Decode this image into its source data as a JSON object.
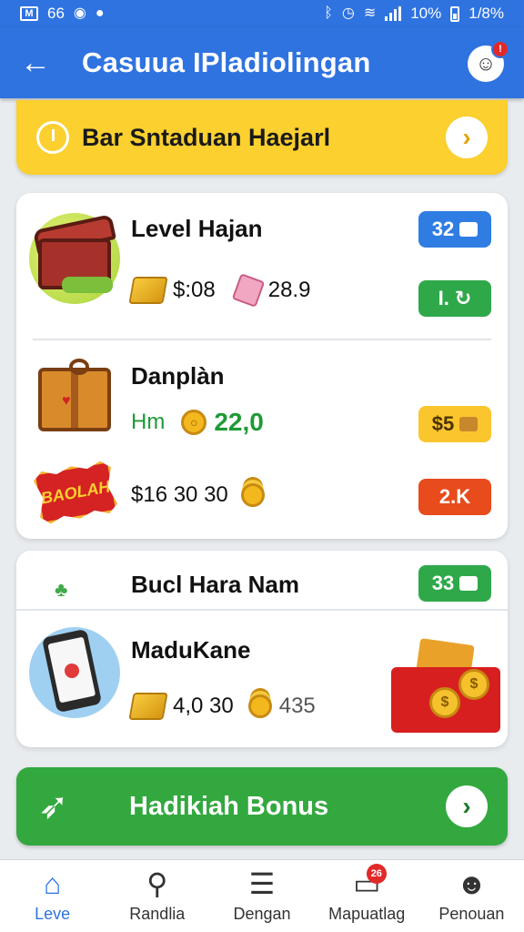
{
  "status_bar": {
    "left_text": "66",
    "right_text": "1/8%",
    "pct_text": "10%",
    "icons": [
      "mail-icon",
      "circle-icon",
      "chat-bubble-icon",
      "bluetooth-icon",
      "alarm-icon",
      "wifi-icon",
      "signal-icon",
      "battery-icon"
    ]
  },
  "app_bar": {
    "title": "Casuua IPladiolingan",
    "back_icon": "arrow-left-icon",
    "action_icon": "user-alert-icon"
  },
  "banner": {
    "text": "Bar Sntaduan Haejarl",
    "icon": "clock-icon"
  },
  "card1": {
    "rows": [
      {
        "title": "Level Hajan",
        "left_value": "$:08",
        "right_value": "28.9",
        "pill_top": "32",
        "pill_bottom": "I."
      },
      {
        "title": "Danplàn",
        "prefix": "Hm",
        "amount": "22,0",
        "pill": "$5"
      },
      {
        "badge_text": "BAOLAH",
        "value": "$16 30 30",
        "pill": "2.K"
      }
    ]
  },
  "card2": {
    "title": "Bucl Hara Nam",
    "pill": "33",
    "sub_title": "MaduKane",
    "left_value": "4,0 30",
    "right_value": "435"
  },
  "cta": {
    "label": "Hadikiah Bonus",
    "icon": "rocket-icon"
  },
  "bottom_nav": [
    {
      "label": "Leve",
      "icon": "home-icon",
      "active": true
    },
    {
      "label": "Randlia",
      "icon": "search-icon",
      "active": false
    },
    {
      "label": "Dengan",
      "icon": "list-icon",
      "active": false
    },
    {
      "label": "Mapuatlag",
      "icon": "chat-icon",
      "active": false,
      "badge": "26"
    },
    {
      "label": "Penouan",
      "icon": "person-icon",
      "active": false
    }
  ],
  "colors": {
    "primary": "#2f73e0",
    "banner": "#fbd02f",
    "cta": "#33a83f",
    "pill_blue": "#2f7de3",
    "pill_green": "#2fa84a",
    "pill_yellow": "#fbc52e",
    "pill_red": "#e84b1c"
  }
}
